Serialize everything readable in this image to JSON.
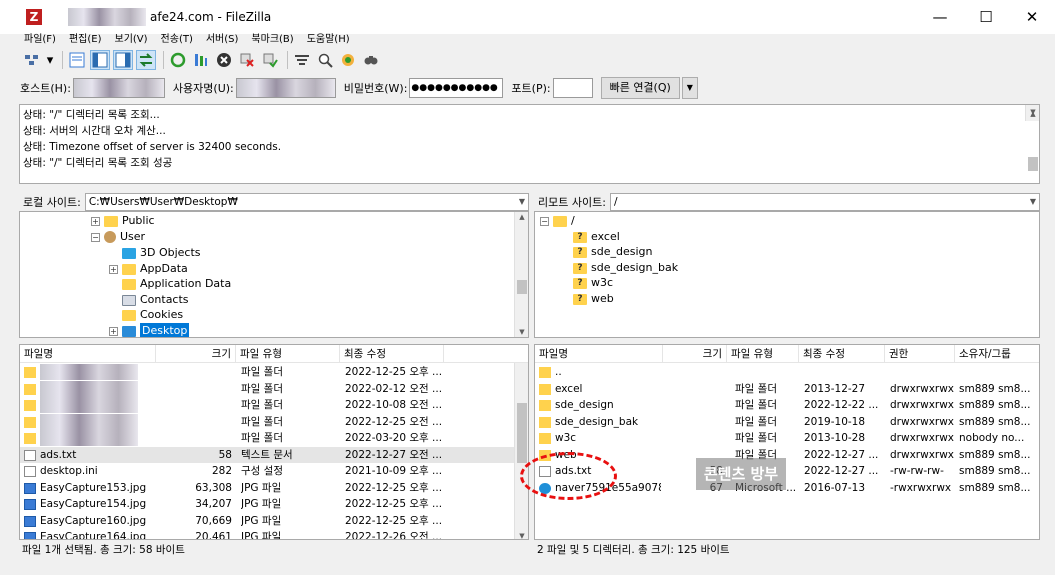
{
  "window": {
    "title": "afe24.com - FileZilla",
    "app_icon": "Z",
    "controls": [
      "—",
      "☐",
      "✕"
    ]
  },
  "menu": [
    "파일(F)",
    "편집(E)",
    "보기(V)",
    "전송(T)",
    "서버(S)",
    "북마크(B)",
    "도움말(H)"
  ],
  "toolbar_icons": [
    "site-manager-icon",
    "dropdown-icon",
    "toggle-log-icon",
    "toggle-local-tree-icon",
    "toggle-remote-tree-icon",
    "toggle-queue-icon",
    "refresh-icon",
    "process-queue-icon",
    "cancel-icon",
    "disconnect-icon",
    "reconnect-icon",
    "filter-icon",
    "compare-icon",
    "sync-browse-icon",
    "search-icon"
  ],
  "quickconnect": {
    "host_label": "호스트(H):",
    "user_label": "사용자명(U):",
    "pass_label": "비밀번호(W):",
    "pass_value": "●●●●●●●●●●●",
    "port_label": "포트(P):",
    "port_value": "",
    "connect_button": "빠른 연결(Q)",
    "dropdown": "▼"
  },
  "log": [
    "상태:  \"/\" 디렉터리 목록 조회...",
    "상태:  서버의 시간대 오차 계산...",
    "상태:  Timezone offset of server is 32400 seconds.",
    "상태:  \"/\" 디렉터리 목록 조회 성공"
  ],
  "local": {
    "site_label": "로컬 사이트:",
    "path": "C:₩Users₩User₩Desktop₩",
    "tree": [
      "Public",
      "User",
      "3D Objects",
      "AppData",
      "Application Data",
      "Contacts",
      "Cookies",
      "Desktop"
    ],
    "columns": [
      "파일명",
      "크기",
      "파일 유형",
      "최종 수정"
    ],
    "files": [
      {
        "name": "",
        "size": "",
        "type": "파일 폴더",
        "modified": "2022-12-25 오후 ..."
      },
      {
        "name": "",
        "size": "",
        "type": "파일 폴더",
        "modified": "2022-02-12 오전 ..."
      },
      {
        "name": "",
        "size": "",
        "type": "파일 폴더",
        "modified": "2022-10-08 오전 ..."
      },
      {
        "name": "",
        "size": "",
        "type": "파일 폴더",
        "modified": "2022-12-25 오전 ..."
      },
      {
        "name": "",
        "size": "",
        "type": "파일 폴더",
        "modified": "2022-03-20 오후 ..."
      },
      {
        "name": "ads.txt",
        "size": "58",
        "type": "텍스트 문서",
        "modified": "2022-12-27 오전 ..."
      },
      {
        "name": "desktop.ini",
        "size": "282",
        "type": "구성 설정",
        "modified": "2021-10-09 오후 ..."
      },
      {
        "name": "EasyCapture153.jpg",
        "size": "63,308",
        "type": "JPG 파일",
        "modified": "2022-12-25 오후 ..."
      },
      {
        "name": "EasyCapture154.jpg",
        "size": "34,207",
        "type": "JPG 파일",
        "modified": "2022-12-25 오후 ..."
      },
      {
        "name": "EasyCapture160.jpg",
        "size": "70,669",
        "type": "JPG 파일",
        "modified": "2022-12-25 오후 ..."
      },
      {
        "name": "EasyCapture164.jpg",
        "size": "20,461",
        "type": "JPG 파일",
        "modified": "2022-12-26 오전 ..."
      }
    ],
    "status": "파일 1개 선택됨. 총 크기: 58 바이트"
  },
  "remote": {
    "site_label": "리모트 사이트:",
    "path": "/",
    "tree": [
      "/",
      "excel",
      "sde_design",
      "sde_design_bak",
      "w3c",
      "web"
    ],
    "columns": [
      "파일명",
      "크기",
      "파일 유형",
      "최종 수정",
      "권한",
      "소유자/그룹"
    ],
    "files": [
      {
        "name": "..",
        "size": "",
        "type": "",
        "modified": "",
        "perm": "",
        "owner": ""
      },
      {
        "name": "excel",
        "size": "",
        "type": "파일 폴더",
        "modified": "2013-12-27",
        "perm": "drwxrwxrwx",
        "owner": "sm889 sm8..."
      },
      {
        "name": "sde_design",
        "size": "",
        "type": "파일 폴더",
        "modified": "2022-12-22 ...",
        "perm": "drwxrwxrwx",
        "owner": "sm889 sm8..."
      },
      {
        "name": "sde_design_bak",
        "size": "",
        "type": "파일 폴더",
        "modified": "2019-10-18",
        "perm": "drwxrwxrwx",
        "owner": "sm889 sm8..."
      },
      {
        "name": "w3c",
        "size": "",
        "type": "파일 폴더",
        "modified": "2013-10-28",
        "perm": "drwxrwxrwx",
        "owner": "nobody no..."
      },
      {
        "name": "web",
        "size": "",
        "type": "파일 폴더",
        "modified": "2022-12-27 ...",
        "perm": "drwxrwxrwx",
        "owner": "sm889 sm8..."
      },
      {
        "name": "ads.txt",
        "size": "58",
        "type": "",
        "modified": "2022-12-27 ...",
        "perm": "-rw-rw-rw-",
        "owner": "sm889 sm8..."
      },
      {
        "name": "naver7591e55a9078...",
        "size": "67",
        "type": "Microsoft ...",
        "modified": "2016-07-13",
        "perm": "-rwxrwxrwx",
        "owner": "sm889 sm8..."
      }
    ],
    "status": "2 파일 및 5 디렉터리. 총 크기: 125 바이트"
  },
  "watermark": "콘텐츠 방부"
}
